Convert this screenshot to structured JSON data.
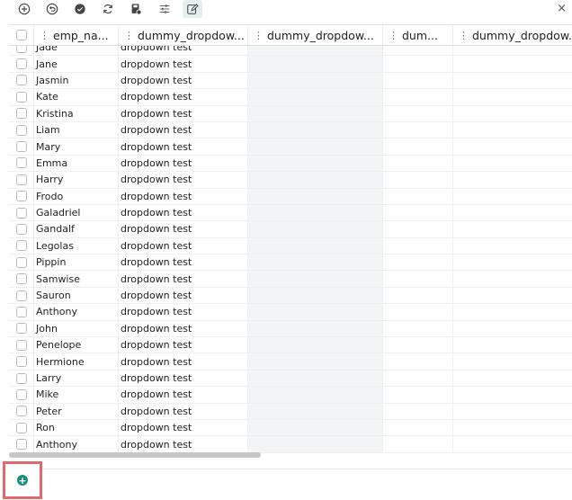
{
  "toolbar": {
    "icons": [
      "add-icon",
      "undo-icon",
      "check-circle-icon",
      "refresh-icon",
      "save-icon",
      "filter-settings-icon",
      "edit-icon"
    ],
    "close_label": "×"
  },
  "table": {
    "columns": [
      "emp_na...",
      "dummy_dropdow...",
      "dummy_dropdow...",
      "dum...",
      "dummy_dropdow..."
    ],
    "rows": [
      {
        "name": "Jade",
        "dropdown": "dropdown test"
      },
      {
        "name": "Jane",
        "dropdown": "dropdown test"
      },
      {
        "name": "Jasmin",
        "dropdown": "dropdown test"
      },
      {
        "name": "Kate",
        "dropdown": "dropdown test"
      },
      {
        "name": "Kristina",
        "dropdown": "dropdown test"
      },
      {
        "name": "Liam",
        "dropdown": "dropdown test"
      },
      {
        "name": "Mary",
        "dropdown": "dropdown test"
      },
      {
        "name": "Emma",
        "dropdown": "dropdown test"
      },
      {
        "name": "Harry",
        "dropdown": "dropdown test"
      },
      {
        "name": "Frodo",
        "dropdown": "dropdown test"
      },
      {
        "name": "Galadriel",
        "dropdown": "dropdown test"
      },
      {
        "name": "Gandalf",
        "dropdown": "dropdown test"
      },
      {
        "name": "Legolas",
        "dropdown": "dropdown test"
      },
      {
        "name": "Pippin",
        "dropdown": "dropdown test"
      },
      {
        "name": "Samwise",
        "dropdown": "dropdown test"
      },
      {
        "name": "Sauron",
        "dropdown": "dropdown test"
      },
      {
        "name": "Anthony",
        "dropdown": "dropdown test"
      },
      {
        "name": "John",
        "dropdown": "dropdown test"
      },
      {
        "name": "Penelope",
        "dropdown": "dropdown test"
      },
      {
        "name": "Hermione",
        "dropdown": "dropdown test"
      },
      {
        "name": "Larry",
        "dropdown": "dropdown test"
      },
      {
        "name": "Mike",
        "dropdown": "dropdown test"
      },
      {
        "name": "Peter",
        "dropdown": "dropdown test"
      },
      {
        "name": "Ron",
        "dropdown": "dropdown test"
      },
      {
        "name": "Anthony",
        "dropdown": "dropdown test"
      }
    ]
  },
  "footer": {
    "add_row_icon": "plus-circle-icon",
    "add_row_glyph": "+"
  },
  "colors": {
    "accent": "#1d8f78",
    "highlight_border": "#e0696b",
    "active_toolbar_bg": "#e3f0ee",
    "shaded_column": "#f3f4f5"
  }
}
